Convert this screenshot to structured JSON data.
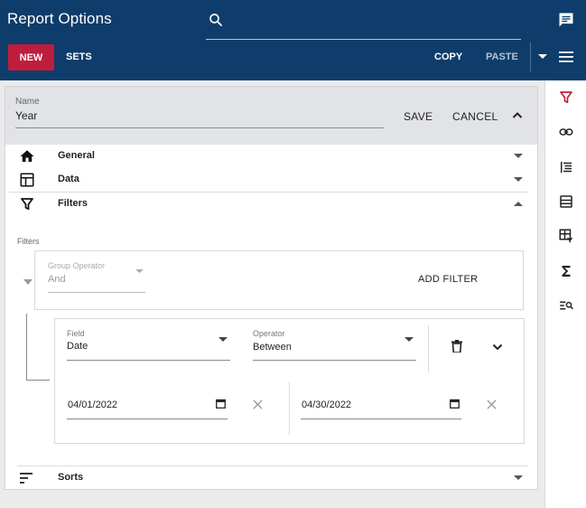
{
  "header": {
    "title": "Report Options",
    "search_placeholder": "",
    "search_value": ""
  },
  "toolbar": {
    "new_label": "NEW",
    "sets_label": "SETS",
    "copy_label": "COPY",
    "paste_label": "PASTE"
  },
  "name_section": {
    "label": "Name",
    "value": "Year",
    "save_label": "SAVE",
    "cancel_label": "CANCEL"
  },
  "sections": [
    {
      "label": "General",
      "icon": "home-icon",
      "expanded": false
    },
    {
      "label": "Data",
      "icon": "table-icon",
      "expanded": false
    },
    {
      "label": "Filters",
      "icon": "filter-icon",
      "expanded": true
    },
    {
      "label": "Sorts",
      "icon": "sort-icon",
      "expanded": false
    }
  ],
  "filters": {
    "caption": "Filters",
    "group_operator_label": "Group Operator",
    "group_operator_value": "And",
    "add_filter_label": "ADD FILTER",
    "filter": {
      "field_label": "Field",
      "field_value": "Date",
      "operator_label": "Operator",
      "operator_value": "Between",
      "from_date": "04/01/2022",
      "to_date": "04/30/2022"
    }
  },
  "right_rail": [
    {
      "icon": "filter-icon",
      "active": true
    },
    {
      "icon": "link-icon",
      "active": false
    },
    {
      "icon": "list-indent-icon",
      "active": false
    },
    {
      "icon": "table-rows-icon",
      "active": false
    },
    {
      "icon": "table-filter-icon",
      "active": false
    },
    {
      "icon": "sigma-icon",
      "active": false
    },
    {
      "icon": "search-list-icon",
      "active": false
    }
  ],
  "colors": {
    "header_bg": "#0f3d6b",
    "accent": "#be1e3c",
    "panel_bg": "#ffffff",
    "name_bg": "#e1e3e7"
  }
}
